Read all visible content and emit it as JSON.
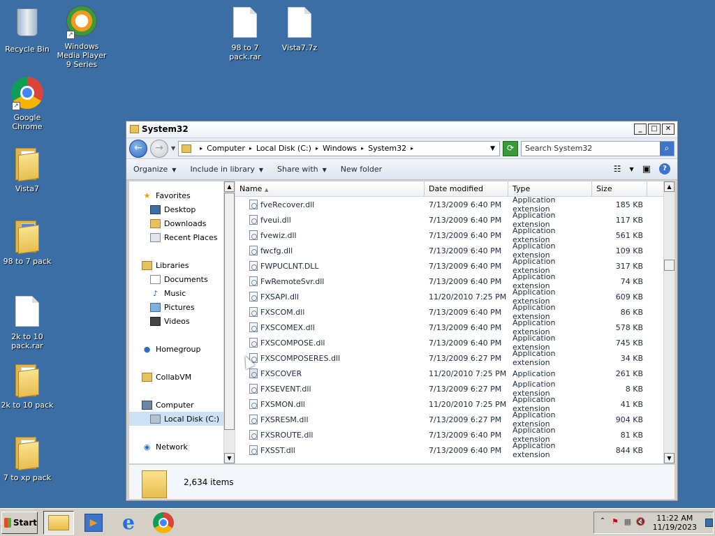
{
  "desktop": {
    "icons": [
      {
        "label": "Recycle Bin"
      },
      {
        "label": "Windows Media Player 9 Series"
      },
      {
        "label": "98 to 7 pack.rar"
      },
      {
        "label": "Vista7.7z"
      },
      {
        "label": "Google Chrome"
      },
      {
        "label": "Vista7"
      },
      {
        "label": "98 to 7 pack"
      },
      {
        "label": "2k to 10 pack.rar"
      },
      {
        "label": "2k to 10 pack"
      },
      {
        "label": "7 to xp pack"
      }
    ]
  },
  "window": {
    "title": "System32",
    "min": "_",
    "max": "□",
    "close": "✕",
    "breadcrumb": [
      "Computer",
      "Local Disk (C:)",
      "Windows",
      "System32"
    ],
    "search_placeholder": "Search System32",
    "toolbar": {
      "organize": "Organize",
      "include": "Include in library",
      "share": "Share with",
      "newfolder": "New folder"
    },
    "nav": {
      "favorites": "Favorites",
      "desktop": "Desktop",
      "downloads": "Downloads",
      "recent": "Recent Places",
      "libraries": "Libraries",
      "documents": "Documents",
      "music": "Music",
      "pictures": "Pictures",
      "videos": "Videos",
      "homegroup": "Homegroup",
      "collabvm": "CollabVM",
      "computer": "Computer",
      "localdisk": "Local Disk (C:)",
      "network": "Network"
    },
    "columns": {
      "name": "Name",
      "date": "Date modified",
      "type": "Type",
      "size": "Size"
    },
    "files": [
      {
        "name": "fveRecover.dll",
        "date": "7/13/2009 6:40 PM",
        "type": "Application extension",
        "size": "185 KB"
      },
      {
        "name": "fveui.dll",
        "date": "7/13/2009 6:40 PM",
        "type": "Application extension",
        "size": "117 KB"
      },
      {
        "name": "fvewiz.dll",
        "date": "7/13/2009 6:40 PM",
        "type": "Application extension",
        "size": "561 KB"
      },
      {
        "name": "fwcfg.dll",
        "date": "7/13/2009 6:40 PM",
        "type": "Application extension",
        "size": "109 KB"
      },
      {
        "name": "FWPUCLNT.DLL",
        "date": "7/13/2009 6:40 PM",
        "type": "Application extension",
        "size": "317 KB"
      },
      {
        "name": "FwRemoteSvr.dll",
        "date": "7/13/2009 6:40 PM",
        "type": "Application extension",
        "size": "74 KB"
      },
      {
        "name": "FXSAPI.dll",
        "date": "11/20/2010 7:25 PM",
        "type": "Application extension",
        "size": "609 KB"
      },
      {
        "name": "FXSCOM.dll",
        "date": "7/13/2009 6:40 PM",
        "type": "Application extension",
        "size": "86 KB"
      },
      {
        "name": "FXSCOMEX.dll",
        "date": "7/13/2009 6:40 PM",
        "type": "Application extension",
        "size": "578 KB"
      },
      {
        "name": "FXSCOMPOSE.dll",
        "date": "7/13/2009 6:40 PM",
        "type": "Application extension",
        "size": "745 KB"
      },
      {
        "name": "FXSCOMPOSERES.dll",
        "date": "7/13/2009 6:27 PM",
        "type": "Application extension",
        "size": "34 KB"
      },
      {
        "name": "FXSCOVER",
        "date": "11/20/2010 7:25 PM",
        "type": "Application",
        "size": "261 KB"
      },
      {
        "name": "FXSEVENT.dll",
        "date": "7/13/2009 6:27 PM",
        "type": "Application extension",
        "size": "8 KB"
      },
      {
        "name": "FXSMON.dll",
        "date": "11/20/2010 7:25 PM",
        "type": "Application extension",
        "size": "41 KB"
      },
      {
        "name": "FXSRESM.dll",
        "date": "7/13/2009 6:27 PM",
        "type": "Application extension",
        "size": "904 KB"
      },
      {
        "name": "FXSROUTE.dll",
        "date": "7/13/2009 6:40 PM",
        "type": "Application extension",
        "size": "81 KB"
      },
      {
        "name": "FXSST.dll",
        "date": "7/13/2009 6:40 PM",
        "type": "Application extension",
        "size": "844 KB"
      }
    ],
    "status": "2,634 items"
  },
  "taskbar": {
    "start": "Start",
    "time": "11:22 AM",
    "date": "11/19/2023"
  }
}
